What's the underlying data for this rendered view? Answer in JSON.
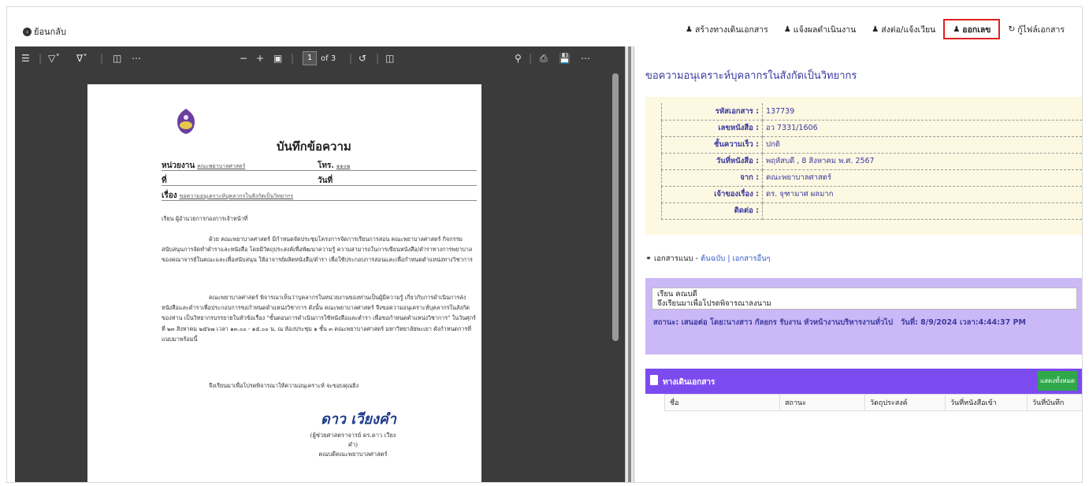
{
  "topbar": {
    "back_label": "ย้อนกลับ",
    "tools": [
      {
        "label": "สร้างทางเดินเอกสาร",
        "icon": "person-icon"
      },
      {
        "label": "แจ้งผลดำเนินงาน",
        "icon": "person-icon"
      },
      {
        "label": "ส่งต่อ/แจ้งเวียน",
        "icon": "person-icon"
      },
      {
        "label": "ออกเลข",
        "icon": "person-icon"
      },
      {
        "label": "กู้ไฟล์เอกสาร",
        "icon": "refresh-icon"
      }
    ]
  },
  "pdf": {
    "page_number": "1",
    "page_total": "of 3",
    "memo_title": "บันทึกข้อความ",
    "dept_label": "หน่วยงาน",
    "dept_value": "คณะพยาบาลศาสตร์",
    "tel_label": "โทร.",
    "tel_value": "๑๑๐๒",
    "ref_label": "ที่",
    "date_label": "วันที่",
    "subject_label": "เรื่อง",
    "subject_value": "ขอความอนุเคราะห์บุคลากรในสังกัดเป็นวิทยากร",
    "salutation": "เรียน ผู้อำนวยการกองการเจ้าหน้าที่",
    "para1": "ด้วย คณะพยาบาลศาสตร์ มีกำหนดจัดประชุมโครงการจัดการเรียนการสอน คณะพยาบาลศาสตร์ กิจกรรมสนับสนุนการจัดทำตำราและหนังสือ โดยมีวัตถุประสงค์เพื่อพัฒนาความรู้ ความสามารถในการเขียนหนังสือ/ตำราทางการพยาบาลของคณาจารย์ในคณะและเพื่อสนับสนุน ให้อาจารย์ผลิตหนังสือ/ตำรา เพื่อใช้ประกอบการสอนและเพื่อกำหนดตำแหน่งทางวิชาการ",
    "para2": "คณะพยาบาลศาสตร์ พิจารณาเห็นว่าบุคลากรในหน่วยงานของท่านเป็นผู้มีความรู้ เกี่ยวกับการดำเนินการส่งหนังสือและตำราเพื่อประกอบการขอกำหนดตำแหน่งวิชาการ ดังนั้น คณะพยาบาลศาสตร์ จึงขอความอนุเคราะห์บุคลากรในสังกัดของท่าน เป็นวิทยากรบรรยายในหัวข้อเรื่อง \"ขั้นตอนการดำเนินการใช้หนังสือและตำรา เพื่อขอกำหนดตำแหน่งวิชาการ\" ในวันศุกร์ที่ ๒๓ สิงหาคม ๒๕๖๗ เวลา ๑๓.๐๐ - ๑๕.๐๐ น. ณ ห้องประชุม ๑ ชั้น ๓ คณะพยาบาลศาสตร์ มหาวิทยาลัยพะเยา ดังกำหนดการที่แนบมาพร้อมนี้",
    "closing": "จึงเรียนมาเพื่อโปรดพิจารณาให้ความอนุเคราะห์ จะขอบคุณยิ่ง",
    "signature": "ดาว เวียงคำ",
    "signer_name": "(ผู้ช่วยศาสตราจารย์ ดร.ดาว เวียงคำ)",
    "signer_title": "คณบดีคณะพยาบาลศาสตร์"
  },
  "detail": {
    "title": "ขอความอนุเคราะห์บุคลากรในสังกัดเป็นวิทยากร",
    "fields": [
      {
        "key": "รหัสเอกสาร :",
        "value": "137739"
      },
      {
        "key": "เลขหนังสือ :",
        "value": "อว 7331/1606"
      },
      {
        "key": "ชั้นความเร็ว :",
        "value": "ปกติ"
      },
      {
        "key": "วันที่หนังสือ :",
        "value": "พฤหัสบดี , 8 สิงหาคม พ.ศ. 2567"
      },
      {
        "key": "จาก :",
        "value": "คณะพยาบาลศาสตร์"
      },
      {
        "key": "เจ้าของเรื่อง :",
        "value": "ดร. จุฑามาศ ผลมาก"
      },
      {
        "key": "ติดต่อ :",
        "value": ""
      }
    ],
    "attachment_label": "เอกสารแนบ -",
    "attachment_original": "ต้นฉบับ",
    "attachment_sep": "|",
    "attachment_other": "เอกสารอื่นๆ",
    "status_line1": "เรียน คณบดี",
    "status_line2": "จึงเรียนมาเพื่อโปรดพิจารณาลงนาม",
    "status_label": "สถานะ:",
    "status_value": "เสนอต่อ",
    "by_label": "โดย:",
    "by_value": "นางสาว กัลยกร รับงาน หัวหน้างานบริหารงานทั่วไป",
    "date_label": "วันที่:",
    "date_value": "8/9/2024",
    "time_label": "เวลา:",
    "time_value": "4:44:37 PM",
    "flow_title": "ทางเดินเอกสาร",
    "flow_button": "แสดงทั้งหมด",
    "flow_columns": [
      "ชื่อ",
      "สถานะ",
      "วัตถุประสงค์",
      "วันที่หนังสือเข้า",
      "วันที่บันทึก"
    ]
  },
  "colors": {
    "accent": "#3a3aa0",
    "info_bg": "#fdf8e1",
    "status_bg": "#cbb8f6",
    "flow_bg": "#7b4bf0",
    "button_green": "#2fa84a",
    "highlight_border": "#e02020"
  }
}
